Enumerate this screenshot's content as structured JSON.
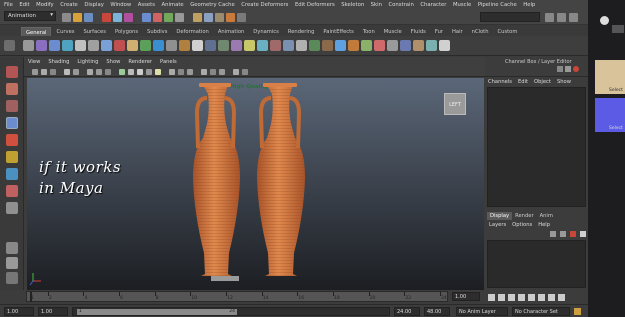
{
  "menubar": {
    "items": [
      "File",
      "Edit",
      "Modify",
      "Create",
      "Display",
      "Window",
      "Assets",
      "Animate",
      "Geometry Cache",
      "Create Deformers",
      "Edit Deformers",
      "Skeleton",
      "Skin",
      "Constrain",
      "Character",
      "Muscle",
      "Pipeline Cache",
      "Help"
    ]
  },
  "statusline": {
    "menuset": "Animation"
  },
  "shelf": {
    "tabs": [
      "General",
      "Curves",
      "Surfaces",
      "Polygons",
      "Subdivs",
      "Deformation",
      "Animation",
      "Dynamics",
      "Rendering",
      "PaintEffects",
      "Toon",
      "Muscle",
      "Fluids",
      "Fur",
      "Hair",
      "nCloth",
      "Custom"
    ],
    "active_tab": "General"
  },
  "viewport": {
    "menus": [
      "View",
      "Shading",
      "Lighting",
      "Show",
      "Renderer",
      "Panels"
    ],
    "hq_label": "High Quality",
    "cube_label": "LEFT",
    "overlay_line1": "if   it   works",
    "overlay_line2": "in   Maya"
  },
  "channelbox": {
    "title": "Channel Box / Layer Editor",
    "menus": [
      "Channels",
      "Edit",
      "Object",
      "Show"
    ]
  },
  "layereditor": {
    "tabs": [
      "Display",
      "Render",
      "Anim"
    ],
    "active_tab": "Display",
    "menus": [
      "Layers",
      "Options",
      "Help"
    ]
  },
  "timeslider": {
    "ticks": [
      "1",
      "2",
      "4",
      "6",
      "8",
      "10",
      "12",
      "14",
      "16",
      "18",
      "20",
      "22",
      "24"
    ],
    "current_frame": "1.00"
  },
  "rangeslider": {
    "start": "1.00",
    "playback_start": "1.00",
    "range_start_label": "1",
    "range_end_label": "24",
    "playback_end": "24.00",
    "end": "48.00",
    "anim_layer": "No Anim Layer",
    "char_set": "No Character Set"
  },
  "rightstrip": {
    "select_label_1": "Select",
    "select_label_2": "Select"
  },
  "colors": {
    "vase": "#d6783f",
    "vase_dark": "#a9532a",
    "hq_text": "#1f7a2d"
  }
}
